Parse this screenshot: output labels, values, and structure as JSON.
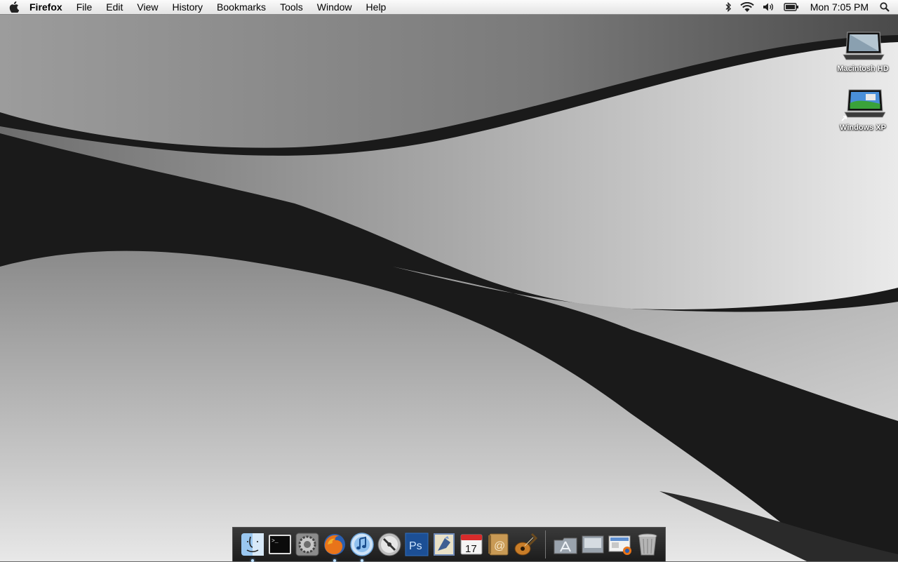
{
  "menubar": {
    "app_name": "Firefox",
    "menus": [
      "File",
      "Edit",
      "View",
      "History",
      "Bookmarks",
      "Tools",
      "Window",
      "Help"
    ],
    "status_icons": [
      "bluetooth-icon",
      "wifi-icon",
      "volume-icon",
      "battery-icon"
    ],
    "clock": "Mon 7:05 PM",
    "spotlight_icon": "spotlight-search-icon"
  },
  "desktop": {
    "icons": [
      {
        "label": "Macintosh HD",
        "icon": "hard-drive-icon"
      },
      {
        "label": "Windows XP",
        "icon": "virtual-machine-alias-icon"
      }
    ]
  },
  "dock": {
    "apps": [
      {
        "name": "Finder",
        "icon": "finder-icon",
        "running": true
      },
      {
        "name": "Terminal",
        "icon": "terminal-icon",
        "running": false
      },
      {
        "name": "System Preferences",
        "icon": "system-preferences-icon",
        "running": false
      },
      {
        "name": "Firefox",
        "icon": "firefox-icon",
        "running": true
      },
      {
        "name": "iTunes",
        "icon": "itunes-icon",
        "running": true
      },
      {
        "name": "DVD Player",
        "icon": "dvd-player-icon",
        "running": false
      },
      {
        "name": "Photoshop",
        "icon": "photoshop-icon",
        "running": false,
        "text": "Ps"
      },
      {
        "name": "Mail",
        "icon": "mail-icon",
        "running": false
      },
      {
        "name": "iCal",
        "icon": "ical-icon",
        "running": false,
        "text": "17"
      },
      {
        "name": "Address Book",
        "icon": "address-book-icon",
        "running": false,
        "text": "@"
      },
      {
        "name": "GarageBand",
        "icon": "garageband-icon",
        "running": false
      }
    ],
    "stacks": [
      {
        "name": "Applications",
        "icon": "applications-folder-icon"
      },
      {
        "name": "Documents",
        "icon": "documents-folder-icon"
      },
      {
        "name": "Downloads",
        "icon": "downloads-stack-icon"
      },
      {
        "name": "Trash",
        "icon": "trash-icon"
      }
    ]
  },
  "colors": {
    "menubar_top": "#fbfbfb",
    "menubar_bottom": "#e3e3e3",
    "dock_bg": "#2a2a2a",
    "running_indicator": "#bfe1ff"
  }
}
